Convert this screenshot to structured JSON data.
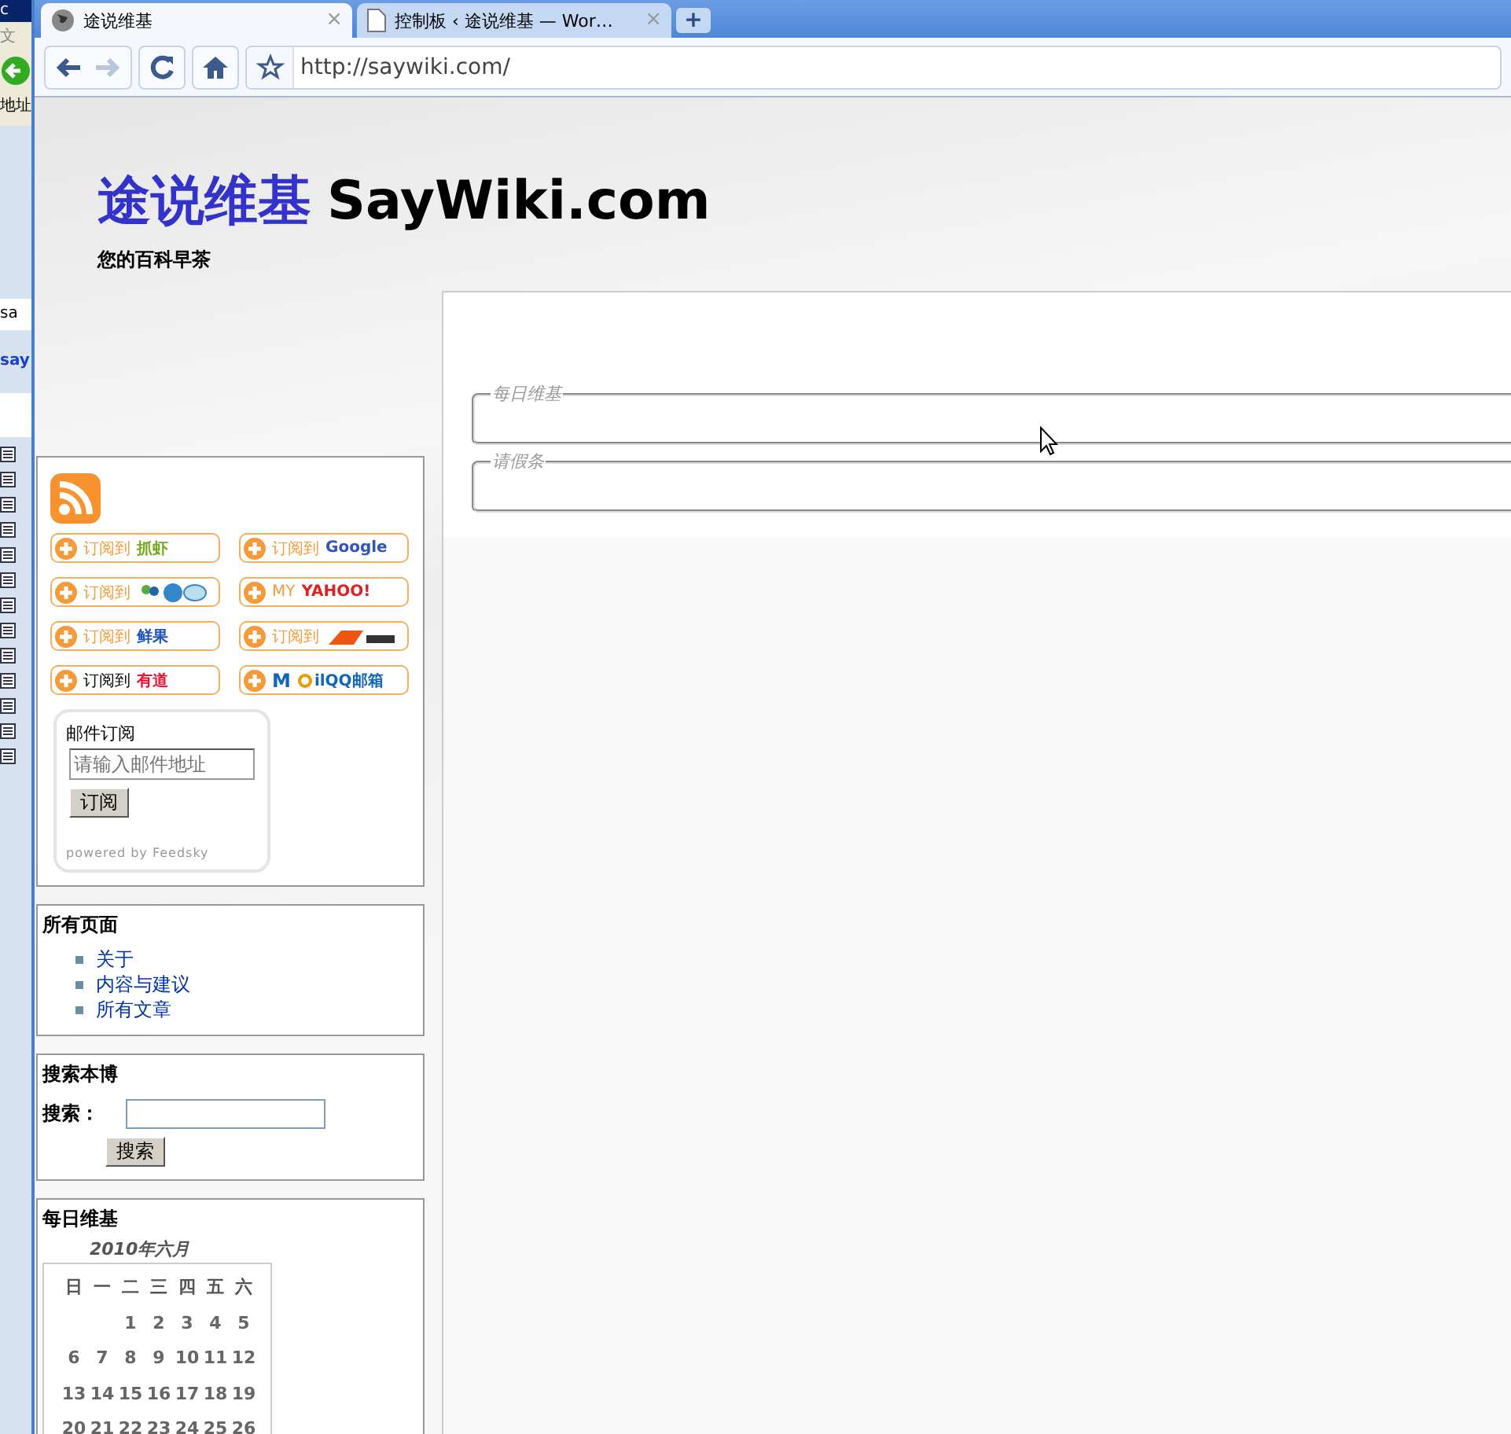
{
  "background_window": {
    "title_fragment": "c",
    "menu_fragment": "文",
    "address_label": "地址",
    "field_text": "sa",
    "link_text": "say"
  },
  "new_tab": "+",
  "tabs": [
    {
      "title": "途说维基",
      "selected": true,
      "kind": "globe",
      "close": "×"
    },
    {
      "title": "控制板 ‹ 途说维基 — Wor…",
      "selected": false,
      "kind": "page",
      "close": "×"
    }
  ],
  "toolbar": {
    "forward_disabled": true,
    "url": "http://saywiki.com/"
  },
  "site": {
    "title_cn": "途说维基",
    "title_en": "SayWiki.com",
    "tagline": "您的百科早茶"
  },
  "feed_widget": {
    "buttons": [
      {
        "kind": "text",
        "prefix": "订阅到",
        "logo": "抓虾",
        "color": "#77aa22"
      },
      {
        "kind": "google",
        "prefix": "订阅到",
        "logo": "Google",
        "color": "#3355bb"
      },
      {
        "kind": "icons",
        "prefix": "订阅到",
        "color": "#3388cc"
      },
      {
        "kind": "text",
        "prefix": "MY",
        "logo": "YAHOO!",
        "color": "#dd2222"
      },
      {
        "kind": "text",
        "prefix": "订阅到",
        "logo": "鲜果",
        "color": "#2255bb"
      },
      {
        "kind": "image",
        "prefix": "订阅到",
        "color": "#ee5511"
      },
      {
        "kind": "dark",
        "prefix": "订阅到",
        "logo": "有道",
        "color": "#ee1133"
      },
      {
        "kind": "qqmail",
        "prefix": "M",
        "logo": "ilQQ邮箱",
        "color": "#1166bb"
      }
    ],
    "email": {
      "label": "邮件订阅",
      "placeholder": "请输入邮件地址",
      "button": "订阅",
      "footer": "powered by Feedsky"
    }
  },
  "pages_widget": {
    "title": "所有页面",
    "links": [
      "关于",
      "内容与建议",
      "所有文章"
    ]
  },
  "search_widget": {
    "title": "搜索本博",
    "label": "搜索：",
    "button": "搜索"
  },
  "calendar_widget": {
    "title": "每日维基",
    "caption": "2010年六月",
    "weekdays": [
      "日",
      "一",
      "二",
      "三",
      "四",
      "五",
      "六"
    ],
    "weeks": [
      [
        "1",
        "2",
        "3",
        "4",
        "5"
      ],
      [
        "6",
        "7",
        "8",
        "9",
        "10",
        "11",
        "12"
      ],
      [
        "13",
        "14",
        "15",
        "16",
        "17",
        "18",
        "19"
      ],
      [
        "20",
        "21",
        "22",
        "23",
        "24",
        "25",
        "26"
      ]
    ]
  },
  "main": {
    "sections": [
      "每日维基",
      "请假条"
    ]
  }
}
